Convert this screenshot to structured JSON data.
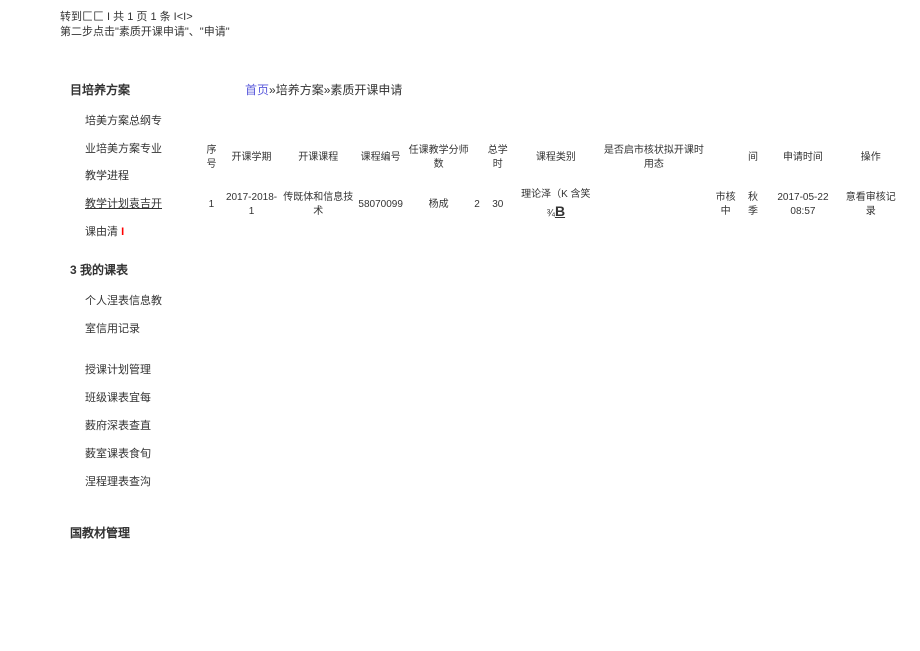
{
  "top_text": {
    "line1": "转到匚匚 I 共 1 页 1 条 I<I>",
    "line2": "第二步点击\"素质开课申请\"、\"申请\""
  },
  "sidebar": {
    "section1": {
      "title": "目培养方案",
      "items": [
        "培美方案总纲专",
        "业培美方案专业",
        "教学进程",
        "教学计划袁吉开",
        "课由清"
      ]
    },
    "section2": {
      "title": "3 我的课表",
      "items": [
        "个人涅表信息教",
        "室信用记录",
        "",
        "授课计划管理",
        "班级课表宜每",
        "薮府深表查直",
        "薮室课表食旬",
        "涅程理表查沟"
      ]
    },
    "section3": {
      "title": "国教材管理"
    }
  },
  "breadcrumb": {
    "home": "首页",
    "sep": "»",
    "level1": "培养方案",
    "level2": "素质开课申请"
  },
  "table": {
    "headers": {
      "seq": "序号",
      "semester": "开课学期",
      "course": "开课课程",
      "code": "课程编号",
      "teacher": "任课教学分师数",
      "credit": "",
      "hours": "总学时",
      "type": "课程类别",
      "enable": "是否启市核状拟开课时用态",
      "status": "",
      "time": "间",
      "apply_time": "申请时间",
      "action": "操作"
    },
    "row1": {
      "seq": "1",
      "semester": "2017-2018-1",
      "course": "传既体和信息技术",
      "code": "58070099",
      "teacher": "杨成",
      "credit": "2",
      "hours": "30",
      "type_prefix": "理论泽（K 含笑¾",
      "type_b": "B",
      "enable": "",
      "status": "市核中",
      "time": "秋季",
      "apply_time": "2017-05-22 08:57",
      "action": "意看审核记录"
    }
  }
}
